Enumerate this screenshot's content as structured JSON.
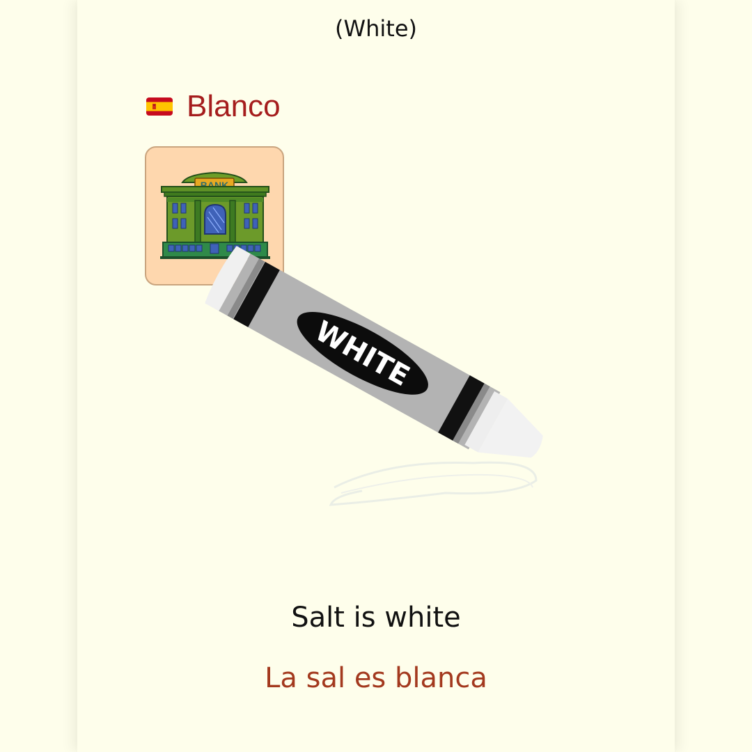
{
  "header": {
    "english_word": "(White)"
  },
  "vocab": {
    "flag_icon": "spain-flag-icon",
    "spanish_word": "Blanco"
  },
  "tile": {
    "icon": "bank-building-icon",
    "sign_text": "BANK",
    "background_color": "#fdc896"
  },
  "illustration": {
    "icon": "white-crayon-icon",
    "label": "WHITE"
  },
  "sentences": {
    "english": "Salt is white",
    "spanish": "La sal es blanca"
  },
  "colors": {
    "background": "#fefeeb",
    "spanish_word": "#a51d1d",
    "spanish_sentence": "#a3391e"
  }
}
